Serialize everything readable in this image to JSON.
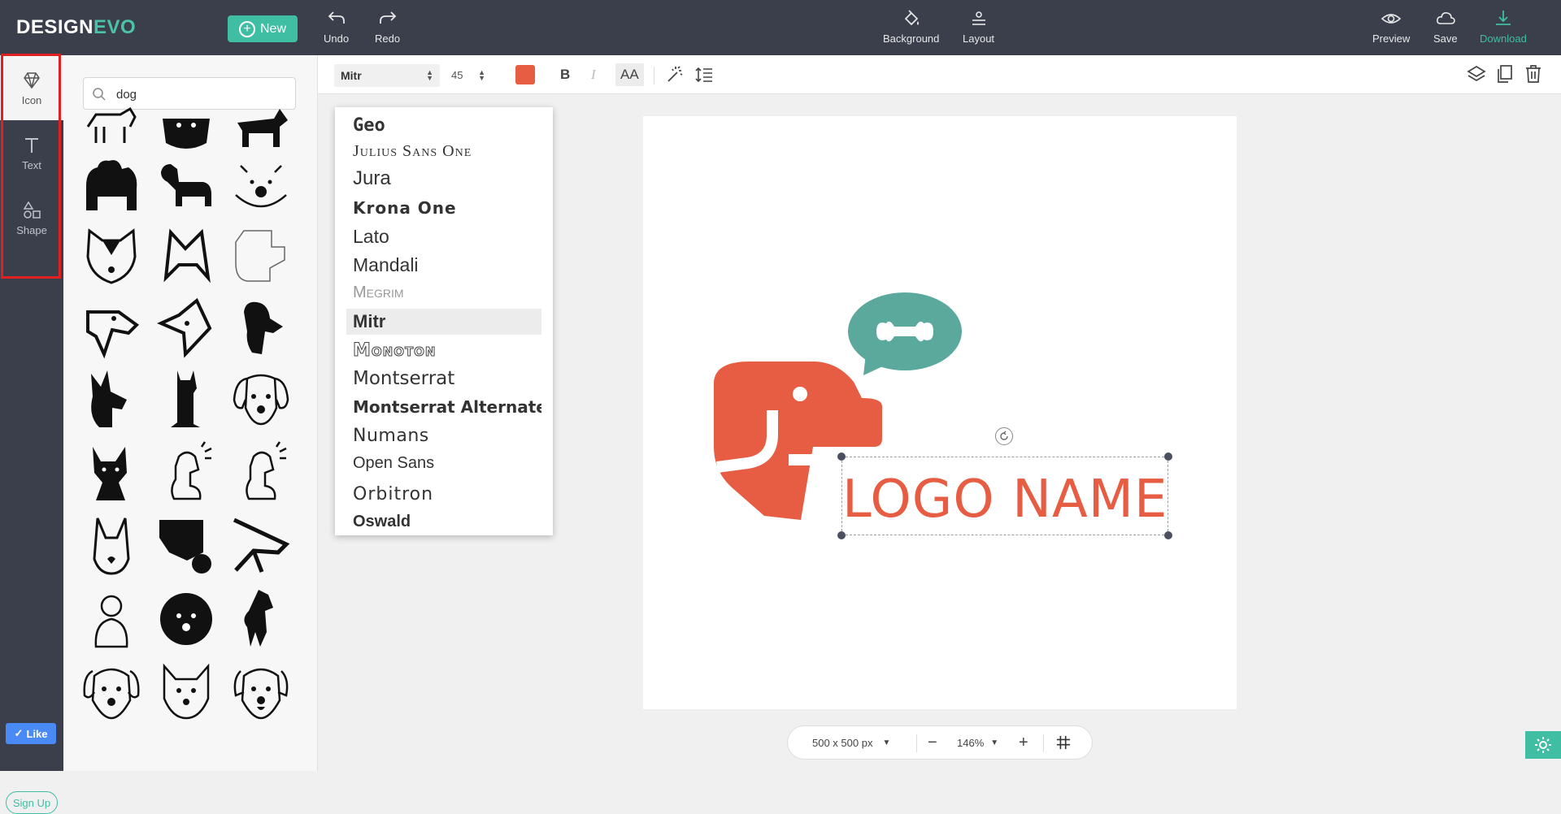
{
  "brand": {
    "part1": "DESIGN",
    "part2": "EVO"
  },
  "topbar": {
    "new_label": "New",
    "undo_label": "Undo",
    "redo_label": "Redo",
    "background_label": "Background",
    "layout_label": "Layout",
    "preview_label": "Preview",
    "save_label": "Save",
    "download_label": "Download"
  },
  "rail": {
    "items": [
      {
        "label": "Icon"
      },
      {
        "label": "Text"
      },
      {
        "label": "Shape"
      }
    ],
    "like_label": "Like",
    "signup_label": "Sign Up"
  },
  "search": {
    "value": "dog"
  },
  "format": {
    "font": "Mitr",
    "size": "45",
    "text_color": "#e65d43",
    "bold_label": "B",
    "italic_label": "I",
    "case_label": "AA"
  },
  "font_list": [
    "Geo",
    "Julius Sans One",
    "Jura",
    "Krona One",
    "Lato",
    "Mandali",
    "Megrim",
    "Mitr",
    "Monoton",
    "Montserrat",
    "Montserrat Alternates",
    "Numans",
    "Open Sans",
    "Orbitron",
    "Oswald"
  ],
  "font_selected": "Mitr",
  "canvas": {
    "logo_text": "LOGO NAME",
    "dog_color": "#e65d43",
    "bubble_color": "#5aa99c"
  },
  "zoombar": {
    "size_label": "500 x 500 px",
    "zoom_label": "146%",
    "minus": "−",
    "plus": "+"
  },
  "colors": {
    "accent": "#3fbea4",
    "dark": "#3a3f4b",
    "brand_orange": "#e65d43"
  }
}
